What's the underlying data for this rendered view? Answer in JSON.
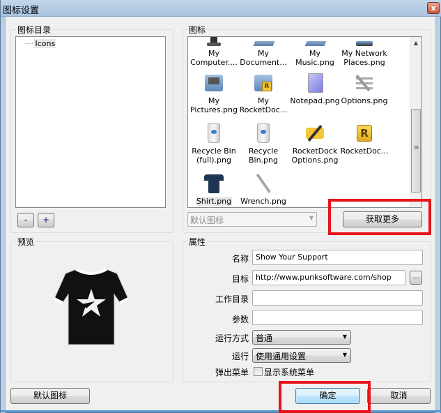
{
  "window": {
    "title": "图标设置",
    "close_label": "x"
  },
  "catalog": {
    "group_label": "图标目录",
    "tree_items": [
      {
        "label": "Icons",
        "selected": true
      }
    ],
    "remove_label": "-",
    "add_label": "+"
  },
  "icons": {
    "group_label": "图标",
    "items": [
      {
        "label": "My Computer....",
        "icon": "my-computer-icon"
      },
      {
        "label": "My Document...",
        "icon": "my-documents-icon"
      },
      {
        "label": "My Music.png",
        "icon": "my-music-icon"
      },
      {
        "label": "My Network Places.png",
        "icon": "network-places-icon"
      },
      {
        "label": "My Pictures.png",
        "icon": "my-pictures-icon"
      },
      {
        "label": "My RocketDoc...",
        "icon": "rocketdock-folder-icon"
      },
      {
        "label": "Notepad.png",
        "icon": "notepad-icon"
      },
      {
        "label": "Options.png",
        "icon": "options-icon"
      },
      {
        "label": "Recycle Bin (full).png",
        "icon": "recycle-bin-full-icon"
      },
      {
        "label": "Recycle Bin.png",
        "icon": "recycle-bin-icon"
      },
      {
        "label": "RocketDock Options.png",
        "icon": "rocketdock-options-icon"
      },
      {
        "label": "RocketDoc...",
        "icon": "rocketdock-icon"
      },
      {
        "label": "Shirt.png",
        "icon": "shirt-icon",
        "selected": true
      },
      {
        "label": "Wrench.png",
        "icon": "wrench-icon"
      }
    ],
    "source_select": "默认图标",
    "get_more_label": "获取更多"
  },
  "preview": {
    "group_label": "预览",
    "image": "t-shirt-star-preview"
  },
  "properties": {
    "group_label": "属性",
    "name_label": "名称",
    "name_value": "Show Your Support",
    "target_label": "目标",
    "target_value": "http://www.punksoftware.com/shop",
    "browse_label": "...",
    "workdir_label": "工作目录",
    "workdir_value": "",
    "args_label": "参数",
    "args_value": "",
    "run_mode_label": "运行方式",
    "run_mode_value": "普通",
    "run_label": "运行",
    "run_value": "使用通用设置",
    "popup_label": "弹出菜单",
    "popup_checkbox_label": "显示系统菜单",
    "popup_checked": false
  },
  "footer": {
    "default_icon_label": "默认图标",
    "ok_label": "确定",
    "cancel_label": "取消"
  },
  "colors": {
    "highlight": "#e8141b",
    "title_bar": "#b8cfe6"
  }
}
